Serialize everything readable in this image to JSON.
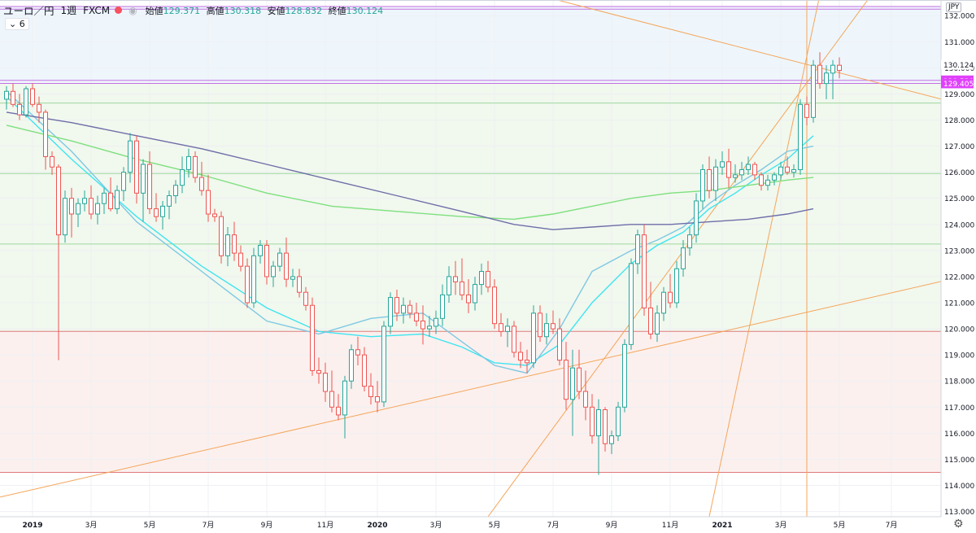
{
  "header": {
    "symbol": "ユーロ／円",
    "interval": "1週",
    "exchange": "FXCM",
    "open_label": "始値",
    "open": "129.371",
    "high_label": "高値",
    "high": "130.318",
    "low_label": "安値",
    "low": "128.832",
    "close_label": "終値",
    "close": "130.124",
    "indicator_label": "6",
    "currency": "JPY",
    "accent_color": "#f7525f"
  },
  "colors": {
    "up": "#26a69a",
    "down": "#ef5350",
    "ma_fast": "#7ec8e3",
    "ma_cyan": "#3ee5f0",
    "ma_green": "#7ee07e",
    "ma_purple": "#6e6ea8",
    "trend": "#f5a55a",
    "hline_magenta": "#c46ee0",
    "hline_red": "#e07a7a",
    "hline_green": "#9ed99e"
  },
  "chart_data": {
    "type": "candlestick",
    "title": "",
    "ylim": [
      112.8,
      132.6
    ],
    "y_ticks": [
      113.0,
      114.0,
      115.0,
      116.0,
      117.0,
      118.0,
      119.0,
      120.0,
      121.0,
      122.0,
      123.0,
      124.0,
      125.0,
      126.0,
      127.0,
      128.0,
      129.0,
      130.0,
      131.0,
      132.0
    ],
    "x_ticks": [
      {
        "label": "2019",
        "week": 4,
        "bold": true
      },
      {
        "label": "3月",
        "week": 13
      },
      {
        "label": "5月",
        "week": 22
      },
      {
        "label": "7月",
        "week": 31
      },
      {
        "label": "9月",
        "week": 40
      },
      {
        "label": "11月",
        "week": 49
      },
      {
        "label": "2020",
        "week": 57,
        "bold": true
      },
      {
        "label": "3月",
        "week": 66
      },
      {
        "label": "5月",
        "week": 75
      },
      {
        "label": "7月",
        "week": 84
      },
      {
        "label": "9月",
        "week": 93
      },
      {
        "label": "11月",
        "week": 102
      },
      {
        "label": "2021",
        "week": 110,
        "bold": true
      },
      {
        "label": "3月",
        "week": 119
      },
      {
        "label": "5月",
        "week": 128
      },
      {
        "label": "7月",
        "week": 136
      }
    ],
    "price_labels": [
      {
        "value": 130.124,
        "text": "130.124",
        "style": "plain"
      },
      {
        "value": 129.52,
        "text": "129.520",
        "style": "magenta"
      },
      {
        "value": 129.405,
        "text": "129.405",
        "style": "magenta"
      }
    ],
    "horizontal_lines": [
      {
        "value": 132.25,
        "color": "magenta"
      },
      {
        "value": 132.35,
        "color": "magenta"
      },
      {
        "value": 129.52,
        "color": "magenta"
      },
      {
        "value": 129.405,
        "color": "magenta"
      },
      {
        "value": 128.65,
        "color": "green"
      },
      {
        "value": 125.95,
        "color": "green"
      },
      {
        "value": 123.25,
        "color": "green"
      },
      {
        "value": 119.9,
        "color": "red"
      },
      {
        "value": 114.5,
        "color": "red"
      }
    ],
    "bands": [
      {
        "from": 129.4,
        "to": 132.35,
        "color": "#eef6fc"
      },
      {
        "from": 119.9,
        "to": 129.4,
        "color": "#f1f8ee"
      },
      {
        "from": 114.5,
        "to": 119.9,
        "color": "#fbf0ee"
      }
    ],
    "vertical_line_week": 123,
    "trendlines": [
      {
        "w1": 80,
        "p1": 132.9,
        "w2": 146,
        "p2": 128.65
      },
      {
        "w1": -1,
        "p1": 113.55,
        "w2": 146,
        "p2": 121.95
      },
      {
        "w1": 74,
        "p1": 112.8,
        "w2": 135,
        "p2": 133.5
      },
      {
        "w1": 108,
        "p1": 112.8,
        "w2": 125,
        "p2": 132.8
      }
    ],
    "candles": [
      [
        128.8,
        129.3,
        128.4,
        129.1
      ],
      [
        129.1,
        129.4,
        128.5,
        128.6
      ],
      [
        128.6,
        129.0,
        128.0,
        128.2
      ],
      [
        128.2,
        129.3,
        128.1,
        129.2
      ],
      [
        129.2,
        129.4,
        128.5,
        128.6
      ],
      [
        128.6,
        128.9,
        127.9,
        128.3
      ],
      [
        128.3,
        128.4,
        126.1,
        126.6
      ],
      [
        126.6,
        126.8,
        125.9,
        126.2
      ],
      [
        126.2,
        126.3,
        118.8,
        123.6
      ],
      [
        123.6,
        125.3,
        123.3,
        125.0
      ],
      [
        125.0,
        125.4,
        123.5,
        124.4
      ],
      [
        124.4,
        125.0,
        123.9,
        124.8
      ],
      [
        124.8,
        125.3,
        124.5,
        125.0
      ],
      [
        125.0,
        125.5,
        124.2,
        124.4
      ],
      [
        124.4,
        125.1,
        124.0,
        124.8
      ],
      [
        124.8,
        125.4,
        124.4,
        125.2
      ],
      [
        125.2,
        125.8,
        124.5,
        124.6
      ],
      [
        124.6,
        125.5,
        124.4,
        125.3
      ],
      [
        125.3,
        126.2,
        124.9,
        126.0
      ],
      [
        126.0,
        127.5,
        125.6,
        127.2
      ],
      [
        127.2,
        127.4,
        124.8,
        125.2
      ],
      [
        125.2,
        126.5,
        124.1,
        126.3
      ],
      [
        126.3,
        126.8,
        124.4,
        124.6
      ],
      [
        124.6,
        125.2,
        124.1,
        124.3
      ],
      [
        124.3,
        124.9,
        123.8,
        124.7
      ],
      [
        124.7,
        125.3,
        124.2,
        125.1
      ],
      [
        125.1,
        125.7,
        124.8,
        125.5
      ],
      [
        125.5,
        126.6,
        125.2,
        126.1
      ],
      [
        126.1,
        126.9,
        125.8,
        126.6
      ],
      [
        126.6,
        126.8,
        125.6,
        125.8
      ],
      [
        125.8,
        126.4,
        125.1,
        125.3
      ],
      [
        125.3,
        125.9,
        124.1,
        124.4
      ],
      [
        124.4,
        124.6,
        124.1,
        124.3
      ],
      [
        124.3,
        124.5,
        122.5,
        122.8
      ],
      [
        122.8,
        123.9,
        122.4,
        123.6
      ],
      [
        123.6,
        124.1,
        122.6,
        122.9
      ],
      [
        122.9,
        123.2,
        122.2,
        122.4
      ],
      [
        122.4,
        122.7,
        120.8,
        121.0
      ],
      [
        121.0,
        123.1,
        120.8,
        122.8
      ],
      [
        122.8,
        123.4,
        122.5,
        123.2
      ],
      [
        123.2,
        123.4,
        121.7,
        122.0
      ],
      [
        122.0,
        122.6,
        121.6,
        122.4
      ],
      [
        122.4,
        123.1,
        122.2,
        122.9
      ],
      [
        122.9,
        123.5,
        121.6,
        121.9
      ],
      [
        121.9,
        122.3,
        121.6,
        122.0
      ],
      [
        122.0,
        122.3,
        121.2,
        121.4
      ],
      [
        121.4,
        121.6,
        120.7,
        120.9
      ],
      [
        120.9,
        121.2,
        118.2,
        118.4
      ],
      [
        118.4,
        118.9,
        117.9,
        118.3
      ],
      [
        118.3,
        118.7,
        117.2,
        117.6
      ],
      [
        117.6,
        118.4,
        116.8,
        117.0
      ],
      [
        117.0,
        117.5,
        116.5,
        116.7
      ],
      [
        116.7,
        118.2,
        115.8,
        118.0
      ],
      [
        118.0,
        119.4,
        117.7,
        119.2
      ],
      [
        119.2,
        119.7,
        118.6,
        119.0
      ],
      [
        119.0,
        119.3,
        117.6,
        117.8
      ],
      [
        117.8,
        118.3,
        117.1,
        117.4
      ],
      [
        117.4,
        118.0,
        116.8,
        117.2
      ],
      [
        117.2,
        120.3,
        117.0,
        120.1
      ],
      [
        120.1,
        121.4,
        119.8,
        121.2
      ],
      [
        121.2,
        121.5,
        120.3,
        120.6
      ],
      [
        120.6,
        121.2,
        120.2,
        120.9
      ],
      [
        120.9,
        121.1,
        120.4,
        120.6
      ],
      [
        120.6,
        121.0,
        120.1,
        120.3
      ],
      [
        120.3,
        120.9,
        119.4,
        120.0
      ],
      [
        120.0,
        120.5,
        119.7,
        120.1
      ],
      [
        120.1,
        120.7,
        119.8,
        120.4
      ],
      [
        120.4,
        121.7,
        120.1,
        121.3
      ],
      [
        121.3,
        122.4,
        121.0,
        122.0
      ],
      [
        122.0,
        122.6,
        121.3,
        121.8
      ],
      [
        121.8,
        122.7,
        121.1,
        121.3
      ],
      [
        121.3,
        121.9,
        120.6,
        121.0
      ],
      [
        121.0,
        122.0,
        120.7,
        121.7
      ],
      [
        121.7,
        122.5,
        121.3,
        122.2
      ],
      [
        122.2,
        122.6,
        121.4,
        121.6
      ],
      [
        121.6,
        121.9,
        120.0,
        120.2
      ],
      [
        120.2,
        120.6,
        119.7,
        119.9
      ],
      [
        119.9,
        120.4,
        119.3,
        120.1
      ],
      [
        120.1,
        120.3,
        118.9,
        119.1
      ],
      [
        119.1,
        119.5,
        118.5,
        118.8
      ],
      [
        118.8,
        119.2,
        118.3,
        118.7
      ],
      [
        118.7,
        120.9,
        118.5,
        120.6
      ],
      [
        120.6,
        120.9,
        119.5,
        119.7
      ],
      [
        119.7,
        120.6,
        119.4,
        120.2
      ],
      [
        120.2,
        120.7,
        119.8,
        120.0
      ],
      [
        120.0,
        120.4,
        118.6,
        118.8
      ],
      [
        118.8,
        119.5,
        116.9,
        117.3
      ],
      [
        117.3,
        119.2,
        115.9,
        118.5
      ],
      [
        118.5,
        119.2,
        117.3,
        117.6
      ],
      [
        117.6,
        118.4,
        116.5,
        117.0
      ],
      [
        117.0,
        117.5,
        115.6,
        115.9
      ],
      [
        115.9,
        117.3,
        114.4,
        116.9
      ],
      [
        116.9,
        117.0,
        115.3,
        115.6
      ],
      [
        115.6,
        116.1,
        115.2,
        115.9
      ],
      [
        115.9,
        117.2,
        115.7,
        117.0
      ],
      [
        117.0,
        119.6,
        116.8,
        119.4
      ],
      [
        119.4,
        122.7,
        119.2,
        122.5
      ],
      [
        122.5,
        123.8,
        122.1,
        123.6
      ],
      [
        123.6,
        124.0,
        120.5,
        120.8
      ],
      [
        120.8,
        121.8,
        119.6,
        119.8
      ],
      [
        119.8,
        120.9,
        119.5,
        120.6
      ],
      [
        120.6,
        121.6,
        120.3,
        121.4
      ],
      [
        121.4,
        122.1,
        120.8,
        121.0
      ],
      [
        121.0,
        122.6,
        120.8,
        122.3
      ],
      [
        122.3,
        123.4,
        122.0,
        123.1
      ],
      [
        123.1,
        123.9,
        122.8,
        123.6
      ],
      [
        123.6,
        125.2,
        123.3,
        124.9
      ],
      [
        124.9,
        126.3,
        124.6,
        126.1
      ],
      [
        126.1,
        126.6,
        125.0,
        125.3
      ],
      [
        125.3,
        126.5,
        124.9,
        126.2
      ],
      [
        126.2,
        126.8,
        125.9,
        126.4
      ],
      [
        126.4,
        126.9,
        125.4,
        125.8
      ],
      [
        125.8,
        126.3,
        125.6,
        125.9
      ],
      [
        125.9,
        126.4,
        125.7,
        126.1
      ],
      [
        126.1,
        126.6,
        125.9,
        126.3
      ],
      [
        126.3,
        126.4,
        125.7,
        125.9
      ],
      [
        125.9,
        126.0,
        125.3,
        125.5
      ],
      [
        125.5,
        125.9,
        125.3,
        125.7
      ],
      [
        125.7,
        126.0,
        125.5,
        125.9
      ],
      [
        125.9,
        126.4,
        125.7,
        126.2
      ],
      [
        126.2,
        126.6,
        125.9,
        126.0
      ],
      [
        126.0,
        126.3,
        125.8,
        126.1
      ],
      [
        126.1,
        128.8,
        125.9,
        128.6
      ],
      [
        128.6,
        128.9,
        127.8,
        128.1
      ],
      [
        128.1,
        130.3,
        127.9,
        130.1
      ],
      [
        130.1,
        130.6,
        129.2,
        129.4
      ],
      [
        129.4,
        130.1,
        128.8,
        129.8
      ],
      [
        129.8,
        130.3,
        128.8,
        130.1
      ],
      [
        130.1,
        130.4,
        129.6,
        129.9
      ]
    ],
    "moving_averages": [
      {
        "name": "",
        "color": "ma_cyan",
        "w": [
          0,
          10,
          20,
          30,
          40,
          48,
          56,
          64,
          70,
          75,
          80,
          85,
          90,
          96,
          100,
          104,
          108,
          112,
          116,
          120,
          124
        ],
        "p": [
          128.9,
          126.5,
          124.3,
          122.4,
          120.8,
          119.9,
          119.7,
          119.8,
          119.3,
          118.7,
          118.6,
          119.4,
          121.0,
          122.5,
          123.2,
          123.7,
          124.6,
          125.2,
          125.9,
          126.5,
          127.4
        ]
      },
      {
        "name": "",
        "color": "ma_fast",
        "w": [
          0,
          10,
          20,
          30,
          40,
          48,
          56,
          64,
          70,
          75,
          80,
          85,
          90,
          96,
          100,
          104,
          108,
          112,
          116,
          120,
          124
        ],
        "p": [
          129.1,
          126.8,
          124.1,
          122.2,
          120.3,
          119.8,
          120.4,
          120.6,
          119.5,
          118.6,
          118.3,
          120.0,
          122.2,
          123.0,
          123.4,
          123.9,
          124.8,
          125.5,
          126.1,
          126.8,
          127.0
        ]
      },
      {
        "name": "",
        "color": "ma_green",
        "w": [
          0,
          10,
          20,
          30,
          40,
          50,
          60,
          70,
          78,
          84,
          90,
          96,
          102,
          108,
          114,
          120,
          124
        ],
        "p": [
          127.8,
          127.2,
          126.5,
          125.9,
          125.2,
          124.7,
          124.5,
          124.3,
          124.2,
          124.4,
          124.7,
          125.0,
          125.2,
          125.3,
          125.5,
          125.7,
          125.8
        ]
      },
      {
        "name": "",
        "color": "ma_purple",
        "w": [
          0,
          10,
          20,
          30,
          40,
          50,
          60,
          70,
          78,
          84,
          90,
          96,
          102,
          108,
          114,
          120,
          124
        ],
        "p": [
          128.3,
          127.9,
          127.4,
          126.9,
          126.3,
          125.7,
          125.1,
          124.5,
          124.0,
          123.8,
          123.9,
          124.0,
          124.0,
          124.1,
          124.2,
          124.4,
          124.6
        ]
      }
    ]
  }
}
